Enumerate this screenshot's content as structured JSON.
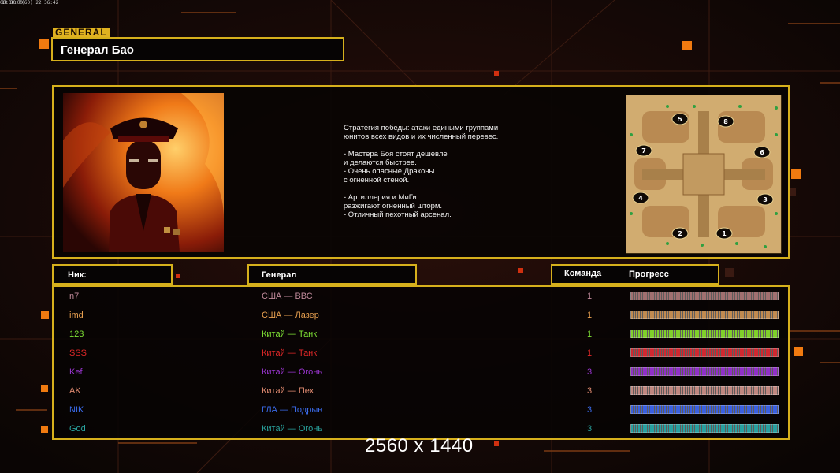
{
  "topbar": {
    "left": "1R 30 7(60) 22:36:42",
    "right": "00:00:00"
  },
  "general_tag": "GENERAL",
  "general_name": "Генерал Бао",
  "strategy_lines": [
    "Стратегия победы: атаки едиными группами",
    "юнитов всех видов и их численный перевес.",
    "",
    "- Мастера Боя стоят дешевле",
    "и делаются быстрее.",
    "- Очень опасные Драконы",
    "с огненной стеной.",
    "",
    "- Артиллерия и МиГи",
    "разжигают огненный шторм.",
    "- Отличный пехотный арсенал."
  ],
  "headers": {
    "nick": "Ник:",
    "general": "Генерал",
    "team": "Команда",
    "progress": "Прогресс"
  },
  "map_slots": [
    "1",
    "2",
    "3",
    "4",
    "5",
    "6",
    "7",
    "8"
  ],
  "players": [
    {
      "nick": "n7",
      "general": "США — ВВС",
      "team": "1",
      "color": "#c08a9a",
      "bar": "#a07070"
    },
    {
      "nick": "imd",
      "general": "США — Лазер",
      "team": "1",
      "color": "#e8a050",
      "bar": "#c08a50"
    },
    {
      "nick": "123",
      "general": "Китай — Танк",
      "team": "1",
      "color": "#7ee035",
      "bar": "#7fd02a"
    },
    {
      "nick": "SSS",
      "general": "Китай — Танк",
      "team": "1",
      "color": "#e02828",
      "bar": "#d02830"
    },
    {
      "nick": "Kef",
      "general": "Китай — Огонь",
      "team": "3",
      "color": "#9a35d0",
      "bar": "#9030c8"
    },
    {
      "nick": "AK",
      "general": "Китай — Пех",
      "team": "3",
      "color": "#e08a70",
      "bar": "#c08880"
    },
    {
      "nick": "NIK",
      "general": "ГЛА — Подрыв",
      "team": "3",
      "color": "#3a6ae8",
      "bar": "#3a60e0"
    },
    {
      "nick": "God",
      "general": "Китай — Огонь",
      "team": "3",
      "color": "#2aa5a0",
      "bar": "#28a0a0"
    }
  ],
  "resolution_label": "2560 x 1440"
}
